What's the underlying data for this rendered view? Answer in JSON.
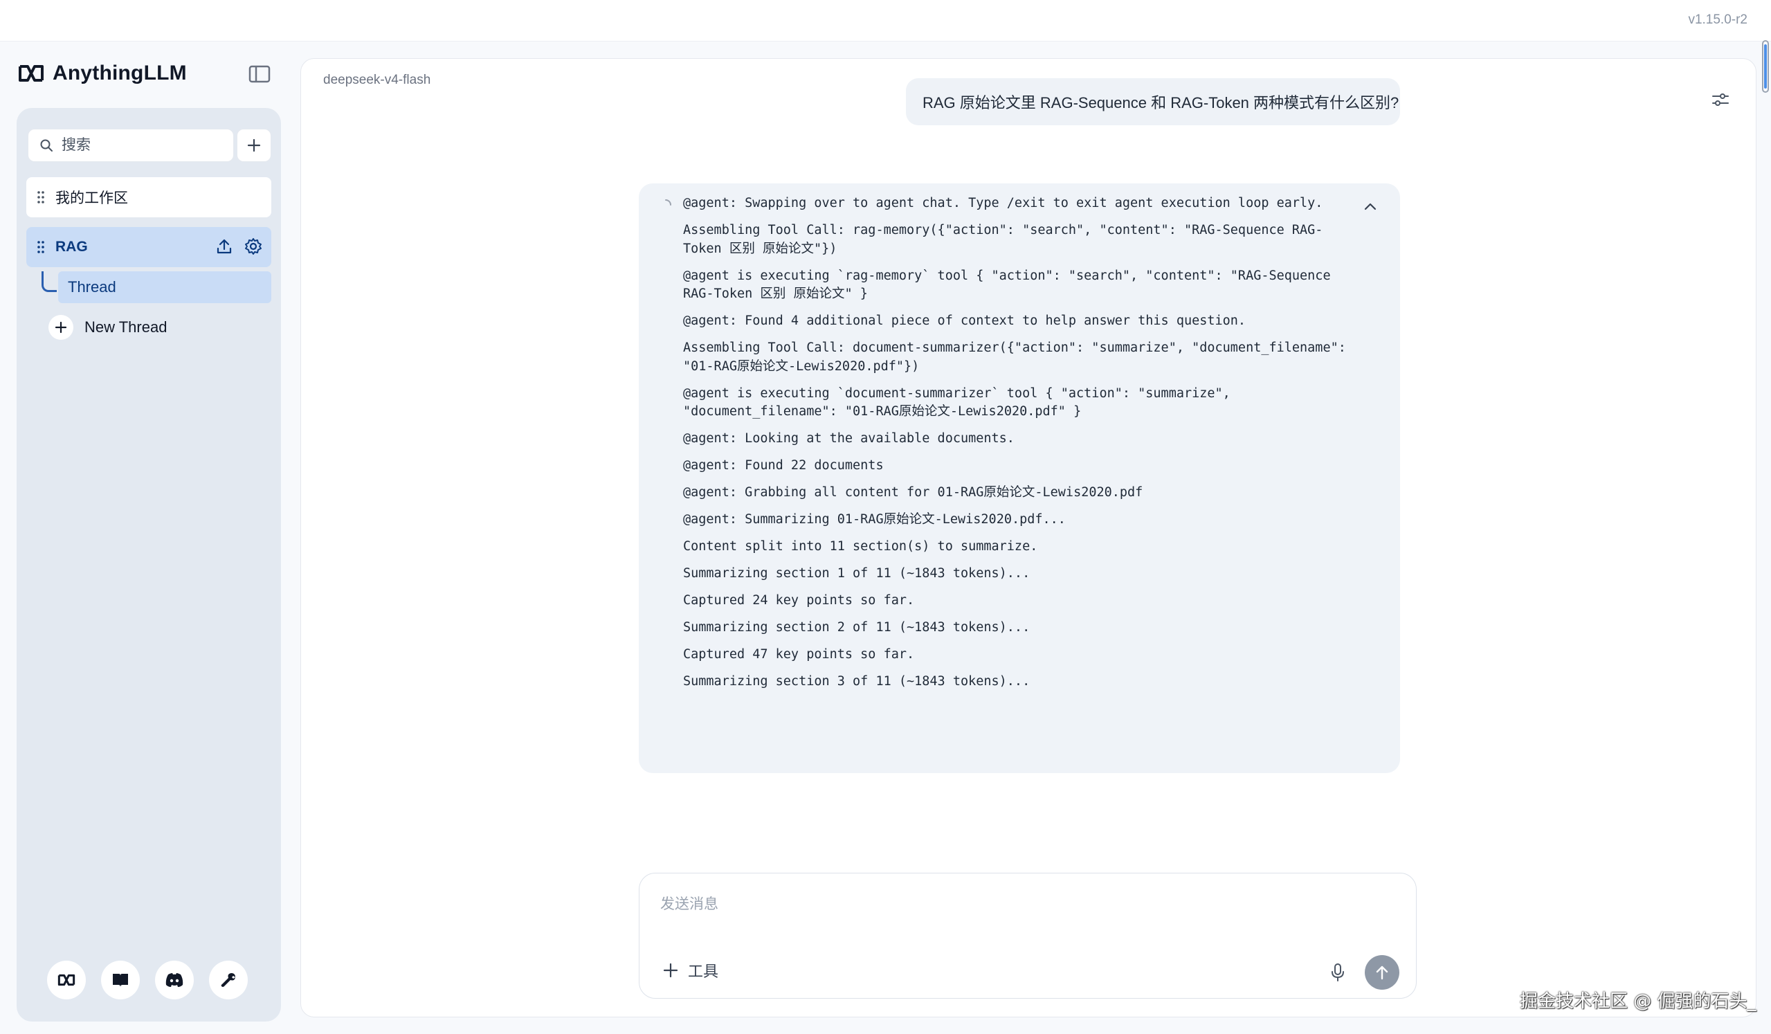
{
  "app": {
    "version": "v1.15.0-r2",
    "brand": "AnythingLLM"
  },
  "sidebar": {
    "search_placeholder": "搜索",
    "workspaces": [
      {
        "name": "我的工作区",
        "active": false
      },
      {
        "name": "RAG",
        "active": true
      }
    ],
    "threads": [
      {
        "name": "Thread",
        "active": true
      }
    ],
    "new_thread_label": "New Thread",
    "footer_icons": [
      "anythingllm-icon",
      "book-icon",
      "discord-icon",
      "wrench-icon"
    ]
  },
  "chat": {
    "model": "deepseek-v4-flash",
    "user_message": "RAG 原始论文里 RAG-Sequence 和 RAG-Token 两种模式有什么区别?",
    "agent_log": [
      "@agent: Swapping over to agent chat. Type /exit to exit agent execution loop early.",
      "Assembling Tool Call: rag-memory({\"action\": \"search\", \"content\": \"RAG-Sequence RAG-Token 区别 原始论文\"})",
      "@agent is executing `rag-memory` tool { \"action\": \"search\", \"content\": \"RAG-Sequence RAG-Token 区别 原始论文\" }",
      "@agent: Found 4 additional piece of context to help answer this question.",
      "Assembling Tool Call: document-summarizer({\"action\": \"summarize\", \"document_filename\": \"01-RAG原始论文-Lewis2020.pdf\"})",
      "@agent is executing `document-summarizer` tool { \"action\": \"summarize\", \"document_filename\": \"01-RAG原始论文-Lewis2020.pdf\" }",
      "@agent: Looking at the available documents.",
      "@agent: Found 22 documents",
      "@agent: Grabbing all content for 01-RAG原始论文-Lewis2020.pdf",
      "@agent: Summarizing 01-RAG原始论文-Lewis2020.pdf...",
      "Content split into 11 section(s) to summarize.",
      "Summarizing section 1 of 11 (~1843 tokens)...",
      "Captured 24 key points so far.",
      "Summarizing section 2 of 11 (~1843 tokens)...",
      "Captured 47 key points so far.",
      "Summarizing section 3 of 11 (~1843 tokens)..."
    ],
    "composer": {
      "placeholder": "发送消息",
      "tools_label": "工具"
    }
  },
  "watermark": "掘金技术社区 @ 倔强的石头_",
  "colors": {
    "accent": "#0b3a7e",
    "active_bg": "#c9dcf6",
    "sidebar_bg": "#e3e9f1",
    "send_btn": "#8e98a6"
  }
}
